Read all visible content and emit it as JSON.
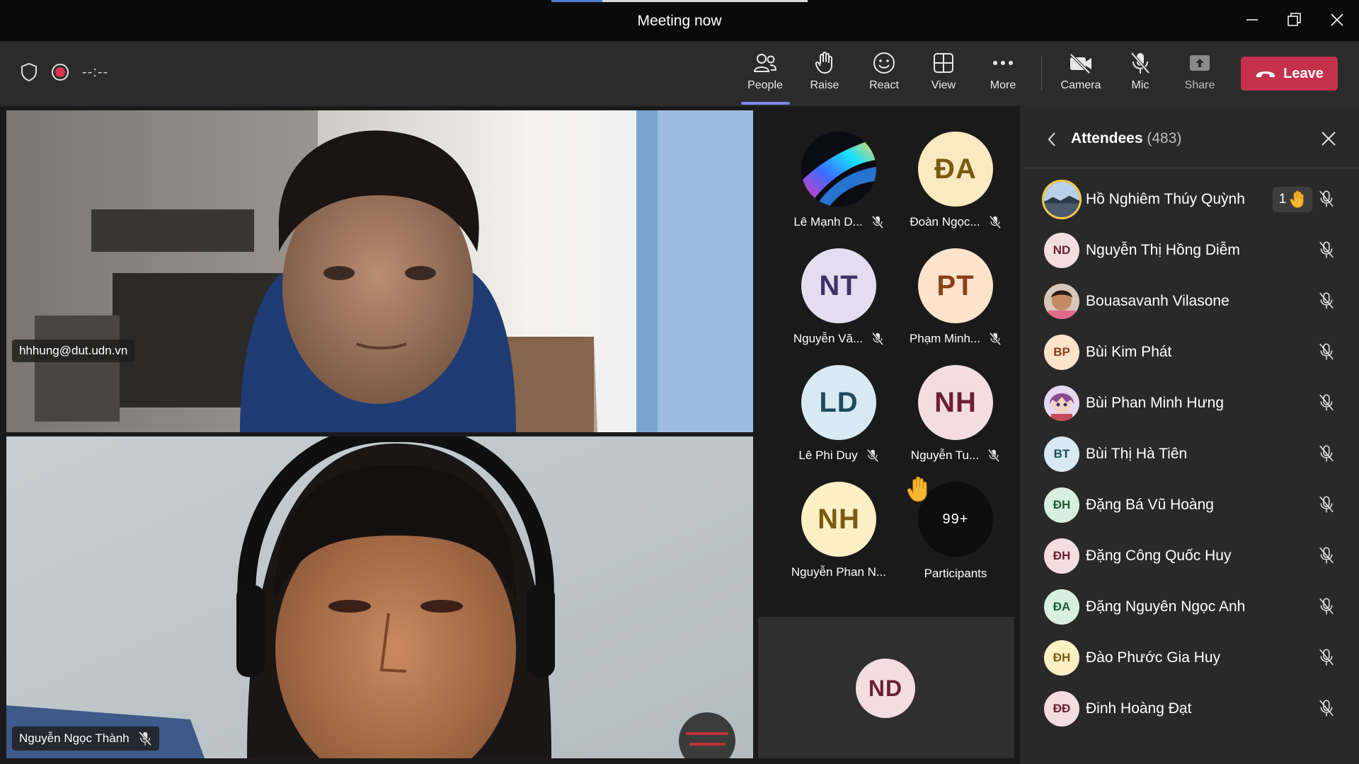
{
  "window": {
    "title": "Meeting now",
    "progress": 0.2
  },
  "toolbar": {
    "timer": "--:--",
    "buttons": {
      "people": "People",
      "raise": "Raise",
      "react": "React",
      "view": "View",
      "more": "More",
      "camera": "Camera",
      "mic": "Mic",
      "share": "Share"
    },
    "leave": "Leave",
    "leave_color": "#c4314b",
    "active_color": "#7f85f5"
  },
  "videos": [
    {
      "name": "hhhung@dut.udn.vn",
      "muted": false
    },
    {
      "name": "Nguyễn Ngọc Thành",
      "muted": true
    }
  ],
  "tiles": [
    {
      "initials": "",
      "name": "Lê Mạnh D...",
      "avatar": "image",
      "muted": true
    },
    {
      "initials": "ĐA",
      "name": "Đoàn Ngọc...",
      "bg": "#fbe9c0",
      "fg": "#7a5a12",
      "muted": true
    },
    {
      "initials": "NT",
      "name": "Nguyễn Vă...",
      "bg": "#e3ddf2",
      "fg": "#3f3366",
      "muted": true
    },
    {
      "initials": "PT",
      "name": "Phạm Minh...",
      "bg": "#fde2cc",
      "fg": "#8a3f14",
      "muted": true
    },
    {
      "initials": "LD",
      "name": "Lê Phi Duy",
      "bg": "#d7e9f2",
      "fg": "#1f4a5e",
      "muted": true
    },
    {
      "initials": "NH",
      "name": "Nguyễn Tu...",
      "bg": "#f3dde2",
      "fg": "#6b1f33",
      "muted": true
    },
    {
      "initials": "NH",
      "name": "Nguyễn Phan N...",
      "bg": "#fdf0c4",
      "fg": "#7a5a12",
      "muted": false
    },
    {
      "initials": "99+",
      "name": "Participants",
      "bg": "#0d0d0d",
      "fg": "#ffffff",
      "muted": false,
      "hand": true
    }
  ],
  "self_tile": {
    "initials": "ND",
    "bg": "#f3dde2",
    "fg": "#6b1f33"
  },
  "panel": {
    "title": "Attendees",
    "count": "(483)",
    "attendees": [
      {
        "name": "Hồ Nghiêm Thúy Quỳnh",
        "initials": "",
        "avatar": "image-sky",
        "raised": "1"
      },
      {
        "name": "Nguyễn Thị Hồng Diễm",
        "initials": "ND",
        "bg": "#f3dde2",
        "fg": "#6b1f33"
      },
      {
        "name": "Bouasavanh Vilasone",
        "initials": "",
        "avatar": "image-child"
      },
      {
        "name": "Bùi Kim Phát",
        "initials": "BP",
        "bg": "#fde2cc",
        "fg": "#8a3f14"
      },
      {
        "name": "Bùi Phan Minh Hưng",
        "initials": "",
        "avatar": "image-anime"
      },
      {
        "name": "Bùi Thị Hà Tiên",
        "initials": "BT",
        "bg": "#d7e9f2",
        "fg": "#1f4a5e"
      },
      {
        "name": "Đặng Bá Vũ Hoàng",
        "initials": "ĐH",
        "bg": "#d7f0e0",
        "fg": "#1d5c35"
      },
      {
        "name": "Đặng Công Quốc Huy",
        "initials": "ĐH",
        "bg": "#f3dde2",
        "fg": "#6b1f33"
      },
      {
        "name": "Đặng Nguyên Ngọc Anh",
        "initials": "ĐA",
        "bg": "#d7f0e0",
        "fg": "#1d5c35"
      },
      {
        "name": "Đào Phước Gia Huy",
        "initials": "ĐH",
        "bg": "#fdf0c4",
        "fg": "#7a5a12"
      },
      {
        "name": "Đinh Hoàng Đạt",
        "initials": "ĐĐ",
        "bg": "#f3dde2",
        "fg": "#6b1f33"
      }
    ]
  }
}
